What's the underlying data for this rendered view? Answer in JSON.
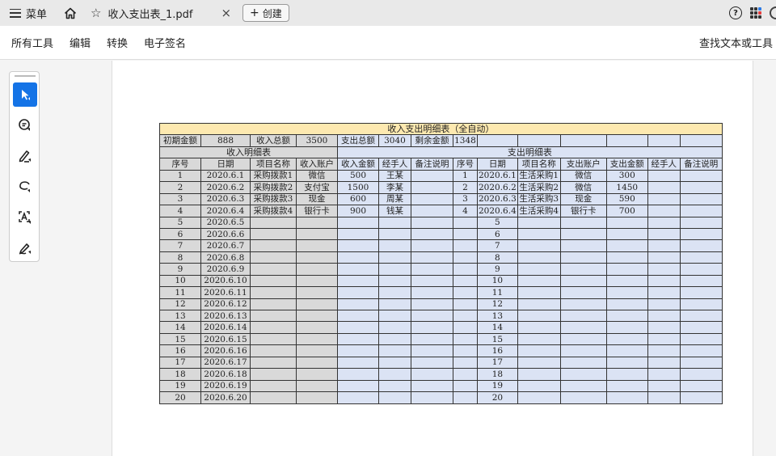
{
  "tabbar": {
    "menu_label": "菜单",
    "tab_title": "收入支出表_1.pdf",
    "close_glyph": "×",
    "create_label": "创建",
    "help_glyph": "?"
  },
  "toolbar": {
    "all_tools": "所有工具",
    "edit": "编辑",
    "convert": "转换",
    "esign": "电子签名",
    "search_tools": "查找文本或工具"
  },
  "tools_panel": {
    "items": [
      "select-cursor-icon",
      "comment-icon",
      "highlight-pen-icon",
      "draw-lasso-icon",
      "text-recognition-icon",
      "sign-pen-icon"
    ]
  },
  "colors": {
    "accent": "#1473e6",
    "title_row": "#fde9b0",
    "income_gray": "#d9d9d9",
    "expense_blue": "#dbe3f4"
  },
  "sheet": {
    "title": "收入支出明细表（全自动）",
    "summary": {
      "initial_label": "初期金额",
      "initial_value": "888",
      "income_total_label": "收入总额",
      "income_total_value": "3500",
      "expense_total_label": "支出总额",
      "expense_total_value": "3040",
      "remaining_label": "剩余金额",
      "remaining_value": "1348"
    },
    "income_section_title": "收入明细表",
    "expense_section_title": "支出明细表",
    "income_headers": [
      "序号",
      "日期",
      "项目名称",
      "收入账户",
      "收入金额",
      "经手人",
      "备注说明"
    ],
    "expense_headers": [
      "序号",
      "日期",
      "项目名称",
      "支出账户",
      "支出金额",
      "经手人",
      "备注说明"
    ],
    "income_rows": [
      [
        "1",
        "2020.6.1",
        "采购拨款1",
        "微信",
        "500",
        "王某",
        ""
      ],
      [
        "2",
        "2020.6.2",
        "采购拨款2",
        "支付宝",
        "1500",
        "李某",
        ""
      ],
      [
        "3",
        "2020.6.3",
        "采购拨款3",
        "现金",
        "600",
        "周某",
        ""
      ],
      [
        "4",
        "2020.6.4",
        "采购拨款4",
        "银行卡",
        "900",
        "钱某",
        ""
      ],
      [
        "5",
        "2020.6.5",
        "",
        "",
        "",
        "",
        ""
      ],
      [
        "6",
        "2020.6.6",
        "",
        "",
        "",
        "",
        ""
      ],
      [
        "7",
        "2020.6.7",
        "",
        "",
        "",
        "",
        ""
      ],
      [
        "8",
        "2020.6.8",
        "",
        "",
        "",
        "",
        ""
      ],
      [
        "9",
        "2020.6.9",
        "",
        "",
        "",
        "",
        ""
      ],
      [
        "10",
        "2020.6.10",
        "",
        "",
        "",
        "",
        ""
      ],
      [
        "11",
        "2020.6.11",
        "",
        "",
        "",
        "",
        ""
      ],
      [
        "12",
        "2020.6.12",
        "",
        "",
        "",
        "",
        ""
      ],
      [
        "13",
        "2020.6.13",
        "",
        "",
        "",
        "",
        ""
      ],
      [
        "14",
        "2020.6.14",
        "",
        "",
        "",
        "",
        ""
      ],
      [
        "15",
        "2020.6.15",
        "",
        "",
        "",
        "",
        ""
      ],
      [
        "16",
        "2020.6.16",
        "",
        "",
        "",
        "",
        ""
      ],
      [
        "17",
        "2020.6.17",
        "",
        "",
        "",
        "",
        ""
      ],
      [
        "18",
        "2020.6.18",
        "",
        "",
        "",
        "",
        ""
      ],
      [
        "19",
        "2020.6.19",
        "",
        "",
        "",
        "",
        ""
      ],
      [
        "20",
        "2020.6.20",
        "",
        "",
        "",
        "",
        ""
      ]
    ],
    "expense_rows": [
      [
        "1",
        "2020.6.1",
        "生活采购1",
        "微信",
        "300",
        "",
        ""
      ],
      [
        "2",
        "2020.6.2",
        "生活采购2",
        "微信",
        "1450",
        "",
        ""
      ],
      [
        "3",
        "2020.6.3",
        "生活采购3",
        "现金",
        "590",
        "",
        ""
      ],
      [
        "4",
        "2020.6.4",
        "生活采购4",
        "银行卡",
        "700",
        "",
        ""
      ],
      [
        "",
        "5",
        "",
        "",
        "",
        "",
        ""
      ],
      [
        "",
        "6",
        "",
        "",
        "",
        "",
        ""
      ],
      [
        "",
        "7",
        "",
        "",
        "",
        "",
        ""
      ],
      [
        "",
        "8",
        "",
        "",
        "",
        "",
        ""
      ],
      [
        "",
        "9",
        "",
        "",
        "",
        "",
        ""
      ],
      [
        "",
        "10",
        "",
        "",
        "",
        "",
        ""
      ],
      [
        "",
        "11",
        "",
        "",
        "",
        "",
        ""
      ],
      [
        "",
        "12",
        "",
        "",
        "",
        "",
        ""
      ],
      [
        "",
        "13",
        "",
        "",
        "",
        "",
        ""
      ],
      [
        "",
        "14",
        "",
        "",
        "",
        "",
        ""
      ],
      [
        "",
        "15",
        "",
        "",
        "",
        "",
        ""
      ],
      [
        "",
        "16",
        "",
        "",
        "",
        "",
        ""
      ],
      [
        "",
        "17",
        "",
        "",
        "",
        "",
        ""
      ],
      [
        "",
        "18",
        "",
        "",
        "",
        "",
        ""
      ],
      [
        "",
        "19",
        "",
        "",
        "",
        "",
        ""
      ],
      [
        "",
        "20",
        "",
        "",
        "",
        "",
        ""
      ]
    ]
  }
}
